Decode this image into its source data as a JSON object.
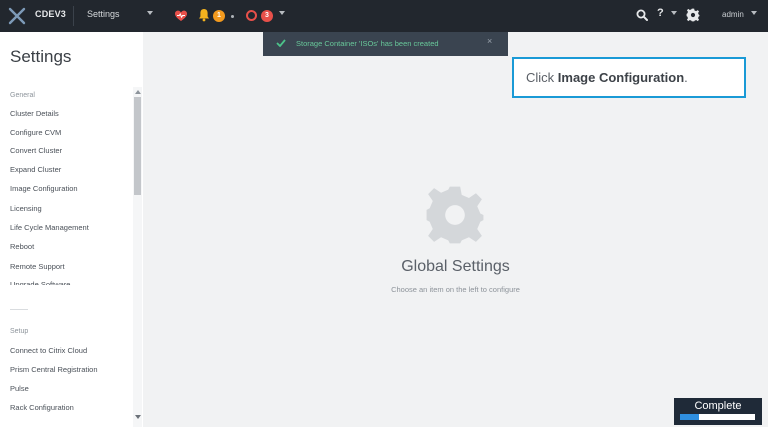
{
  "header": {
    "cluster_name": "CDEV3",
    "section": "Settings",
    "warning_count": "1",
    "alert_count": "3",
    "help_label": "?",
    "user": "admin"
  },
  "toast": {
    "message": "Storage Container 'ISOs' has been created",
    "close_label": "×"
  },
  "sidebar": {
    "title": "Settings",
    "sections": [
      {
        "label": "General",
        "items": [
          "Cluster Details",
          "Configure CVM",
          "Convert Cluster",
          "Expand Cluster",
          "Image Configuration",
          "Licensing",
          "Life Cycle Management",
          "Reboot",
          "Remote Support",
          "Upgrade Software"
        ]
      },
      {
        "label": "Setup",
        "items": [
          "Connect to Citrix Cloud",
          "Prism Central Registration",
          "Pulse",
          "Rack Configuration"
        ]
      }
    ]
  },
  "callout": {
    "prefix": "Click ",
    "target": "Image Configuration",
    "suffix": "."
  },
  "main": {
    "title": "Global Settings",
    "subtitle": "Choose an item on the left to configure"
  },
  "progress": {
    "label": "Complete",
    "value": 0.25,
    "color": "#2f8fe0"
  },
  "icons": [
    "nutanix-logo-icon",
    "heart-health-icon",
    "bell-icon",
    "alert-circle-icon",
    "search-icon",
    "gear-icon",
    "check-icon",
    "close-icon"
  ]
}
